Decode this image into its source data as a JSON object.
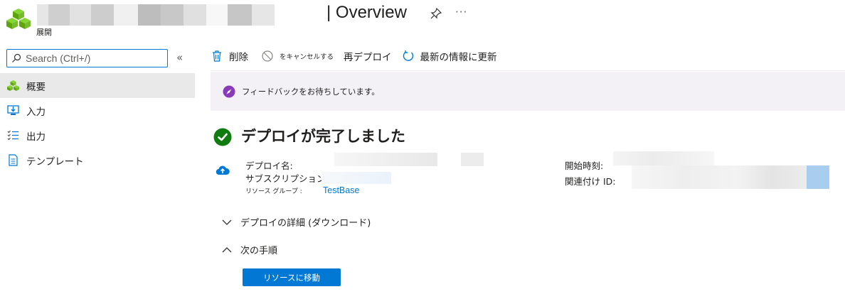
{
  "header": {
    "subtitle": "展開",
    "title_separator_text": "| Overview",
    "pin_icon": "pin-icon",
    "more_label": "···"
  },
  "search": {
    "placeholder": "Search (Ctrl+/)"
  },
  "collapse_label": "«",
  "nav": {
    "items": [
      {
        "label": "概要",
        "icon": "overview-cubes-icon",
        "active": true
      },
      {
        "label": "入力",
        "icon": "input-icon",
        "active": false
      },
      {
        "label": "出力",
        "icon": "output-list-icon",
        "active": false
      },
      {
        "label": "テンプレート",
        "icon": "template-document-icon",
        "active": false
      }
    ]
  },
  "commands": {
    "delete": "削除",
    "cancel": "をキャンセルする",
    "redeploy": "再デプロイ",
    "refresh": "最新の情報に更新"
  },
  "banner": {
    "text": "フィードバックをお待ちしています。"
  },
  "deployment": {
    "status_title": "デプロイが完了しました",
    "name_label": "デプロイ名:",
    "subscription_label": "サブスクリプション:",
    "resource_group_label": "リソース グループ :",
    "resource_group_value": "TestBase",
    "start_time_label": "開始時刻:",
    "correlation_id_label": "関連付け ID:"
  },
  "sections": {
    "details": "デプロイの詳細 (ダウンロード)",
    "next_steps": "次の手順"
  },
  "buttons": {
    "go_to_resource": "リソースに移動"
  },
  "colors": {
    "accent": "#0078d4",
    "success": "#107c10",
    "nav_active_bg": "#e9e9e9",
    "banner_bg": "#f3f0f6",
    "banner_icon": "#8a3ab9"
  }
}
